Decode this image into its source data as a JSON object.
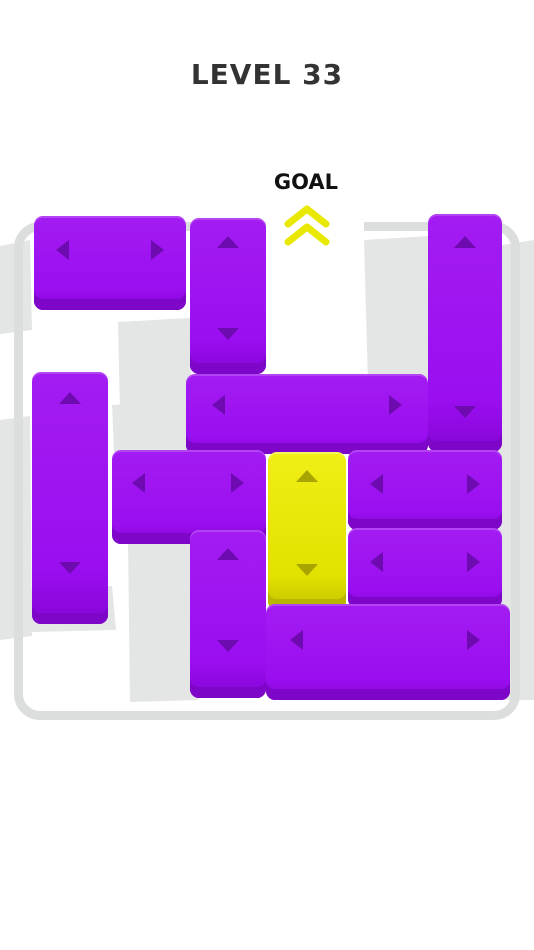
{
  "level": {
    "title": "LEVEL 33"
  },
  "goal": {
    "label": "GOAL",
    "icon": "double-chevron-up-icon"
  },
  "colors": {
    "block": "#9a0ef0",
    "target_block": "#e2e200",
    "arrow": "#6e0bb0",
    "frame": "#dcdede",
    "title": "#333333",
    "goal_label": "#111111",
    "goal_chevron": "#e8e800"
  },
  "blocks": [
    {
      "id": "block-1",
      "type": "horizontal",
      "arrows": [
        "left",
        "right"
      ]
    },
    {
      "id": "block-2",
      "type": "vertical",
      "arrows": [
        "up",
        "down"
      ]
    },
    {
      "id": "block-3",
      "type": "vertical",
      "arrows": [
        "up",
        "down"
      ]
    },
    {
      "id": "block-4",
      "type": "vertical",
      "arrows": [
        "up",
        "down"
      ]
    },
    {
      "id": "block-5",
      "type": "horizontal",
      "arrows": [
        "left",
        "right"
      ]
    },
    {
      "id": "block-6",
      "type": "horizontal",
      "arrows": [
        "left",
        "right"
      ]
    },
    {
      "id": "target-block",
      "type": "vertical",
      "target": true,
      "arrows": [
        "up",
        "down"
      ]
    },
    {
      "id": "block-8",
      "type": "horizontal",
      "arrows": [
        "left",
        "right"
      ]
    },
    {
      "id": "block-9",
      "type": "horizontal",
      "arrows": [
        "left",
        "right"
      ]
    },
    {
      "id": "block-10",
      "type": "vertical",
      "arrows": [
        "up",
        "down"
      ]
    },
    {
      "id": "block-11",
      "type": "horizontal",
      "arrows": [
        "left",
        "right"
      ]
    }
  ]
}
